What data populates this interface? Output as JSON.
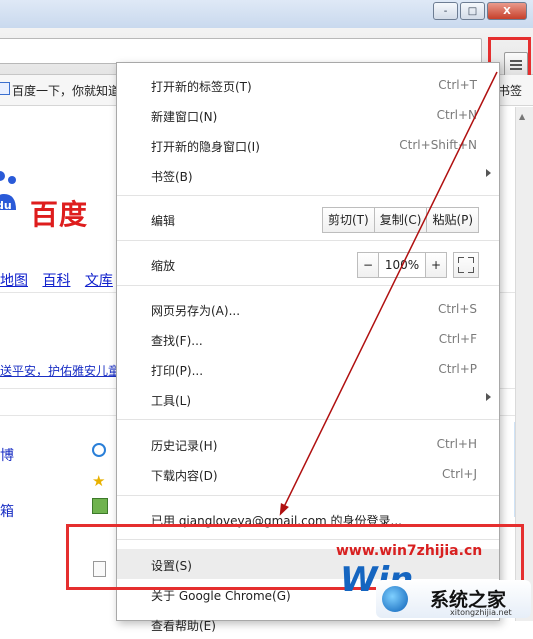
{
  "window": {
    "buttons": [
      "-",
      "□",
      "X"
    ]
  },
  "bookmarks_bar": {
    "left_item": "百度一下，你就知道",
    "right_item": "书签"
  },
  "page": {
    "logo_text": "百度",
    "nav_links": [
      "地图",
      "百科",
      "文库"
    ],
    "news_headline": "送平安，护佑雅安儿童",
    "link_fragment_1": "博",
    "link_fragment_2": "箱"
  },
  "menu": {
    "new_tab": {
      "label": "打开新的标签页(T)",
      "shortcut": "Ctrl+T"
    },
    "new_window": {
      "label": "新建窗口(N)",
      "shortcut": "Ctrl+N"
    },
    "incognito": {
      "label": "打开新的隐身窗口(I)",
      "shortcut": "Ctrl+Shift+N"
    },
    "bookmarks": {
      "label": "书签(B)"
    },
    "edit": {
      "label": "编辑",
      "cut": "剪切(T)",
      "copy": "复制(C)",
      "paste": "粘贴(P)"
    },
    "zoom": {
      "label": "缩放",
      "minus": "−",
      "value": "100%",
      "plus": "+"
    },
    "save_as": {
      "label": "网页另存为(A)...",
      "shortcut": "Ctrl+S"
    },
    "find": {
      "label": "查找(F)...",
      "shortcut": "Ctrl+F"
    },
    "print": {
      "label": "打印(P)...",
      "shortcut": "Ctrl+P"
    },
    "tools": {
      "label": "工具(L)"
    },
    "history": {
      "label": "历史记录(H)",
      "shortcut": "Ctrl+H"
    },
    "downloads": {
      "label": "下载内容(D)",
      "shortcut": "Ctrl+J"
    },
    "signed_in": {
      "label": "已用 qiangloveya@gmail.com 的身份登录..."
    },
    "settings": {
      "label": "设置(S)"
    },
    "about": {
      "label": "关于 Google Chrome(G)"
    },
    "help": {
      "label": "查看帮助(E)"
    }
  },
  "watermark": {
    "url": "www.win7zhijia.cn",
    "brand": "系统之家",
    "w_letters": "Win",
    "site": "xitongzhijia.net"
  },
  "colors": {
    "highlight_box": "#e52f2f",
    "arrow": "#b01010",
    "baidu_red": "#de1d1d",
    "watermark_blue": "#1565c0"
  }
}
